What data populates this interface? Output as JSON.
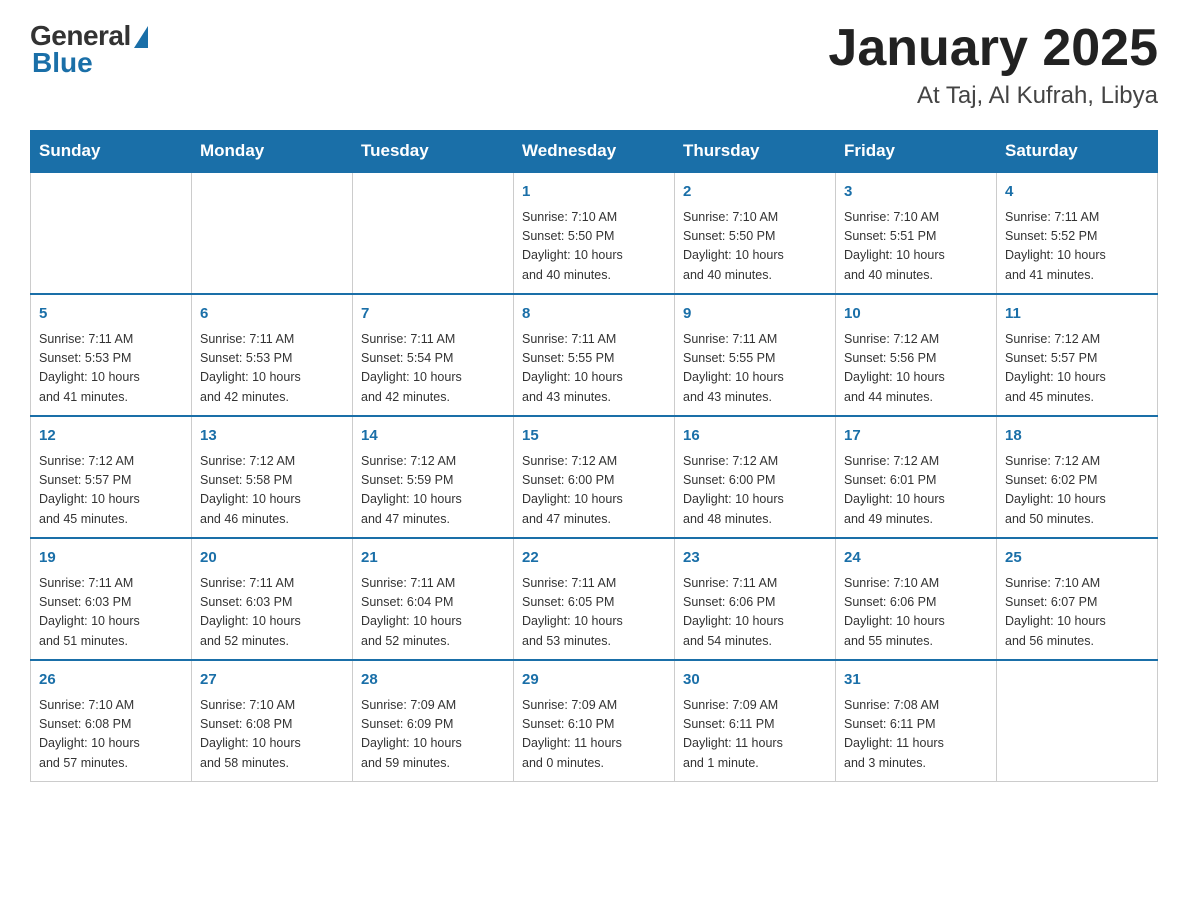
{
  "header": {
    "logo": {
      "general": "General",
      "blue": "Blue"
    },
    "title": "January 2025",
    "location": "At Taj, Al Kufrah, Libya"
  },
  "days_of_week": [
    "Sunday",
    "Monday",
    "Tuesday",
    "Wednesday",
    "Thursday",
    "Friday",
    "Saturday"
  ],
  "weeks": [
    [
      {
        "day": "",
        "info": ""
      },
      {
        "day": "",
        "info": ""
      },
      {
        "day": "",
        "info": ""
      },
      {
        "day": "1",
        "info": "Sunrise: 7:10 AM\nSunset: 5:50 PM\nDaylight: 10 hours\nand 40 minutes."
      },
      {
        "day": "2",
        "info": "Sunrise: 7:10 AM\nSunset: 5:50 PM\nDaylight: 10 hours\nand 40 minutes."
      },
      {
        "day": "3",
        "info": "Sunrise: 7:10 AM\nSunset: 5:51 PM\nDaylight: 10 hours\nand 40 minutes."
      },
      {
        "day": "4",
        "info": "Sunrise: 7:11 AM\nSunset: 5:52 PM\nDaylight: 10 hours\nand 41 minutes."
      }
    ],
    [
      {
        "day": "5",
        "info": "Sunrise: 7:11 AM\nSunset: 5:53 PM\nDaylight: 10 hours\nand 41 minutes."
      },
      {
        "day": "6",
        "info": "Sunrise: 7:11 AM\nSunset: 5:53 PM\nDaylight: 10 hours\nand 42 minutes."
      },
      {
        "day": "7",
        "info": "Sunrise: 7:11 AM\nSunset: 5:54 PM\nDaylight: 10 hours\nand 42 minutes."
      },
      {
        "day": "8",
        "info": "Sunrise: 7:11 AM\nSunset: 5:55 PM\nDaylight: 10 hours\nand 43 minutes."
      },
      {
        "day": "9",
        "info": "Sunrise: 7:11 AM\nSunset: 5:55 PM\nDaylight: 10 hours\nand 43 minutes."
      },
      {
        "day": "10",
        "info": "Sunrise: 7:12 AM\nSunset: 5:56 PM\nDaylight: 10 hours\nand 44 minutes."
      },
      {
        "day": "11",
        "info": "Sunrise: 7:12 AM\nSunset: 5:57 PM\nDaylight: 10 hours\nand 45 minutes."
      }
    ],
    [
      {
        "day": "12",
        "info": "Sunrise: 7:12 AM\nSunset: 5:57 PM\nDaylight: 10 hours\nand 45 minutes."
      },
      {
        "day": "13",
        "info": "Sunrise: 7:12 AM\nSunset: 5:58 PM\nDaylight: 10 hours\nand 46 minutes."
      },
      {
        "day": "14",
        "info": "Sunrise: 7:12 AM\nSunset: 5:59 PM\nDaylight: 10 hours\nand 47 minutes."
      },
      {
        "day": "15",
        "info": "Sunrise: 7:12 AM\nSunset: 6:00 PM\nDaylight: 10 hours\nand 47 minutes."
      },
      {
        "day": "16",
        "info": "Sunrise: 7:12 AM\nSunset: 6:00 PM\nDaylight: 10 hours\nand 48 minutes."
      },
      {
        "day": "17",
        "info": "Sunrise: 7:12 AM\nSunset: 6:01 PM\nDaylight: 10 hours\nand 49 minutes."
      },
      {
        "day": "18",
        "info": "Sunrise: 7:12 AM\nSunset: 6:02 PM\nDaylight: 10 hours\nand 50 minutes."
      }
    ],
    [
      {
        "day": "19",
        "info": "Sunrise: 7:11 AM\nSunset: 6:03 PM\nDaylight: 10 hours\nand 51 minutes."
      },
      {
        "day": "20",
        "info": "Sunrise: 7:11 AM\nSunset: 6:03 PM\nDaylight: 10 hours\nand 52 minutes."
      },
      {
        "day": "21",
        "info": "Sunrise: 7:11 AM\nSunset: 6:04 PM\nDaylight: 10 hours\nand 52 minutes."
      },
      {
        "day": "22",
        "info": "Sunrise: 7:11 AM\nSunset: 6:05 PM\nDaylight: 10 hours\nand 53 minutes."
      },
      {
        "day": "23",
        "info": "Sunrise: 7:11 AM\nSunset: 6:06 PM\nDaylight: 10 hours\nand 54 minutes."
      },
      {
        "day": "24",
        "info": "Sunrise: 7:10 AM\nSunset: 6:06 PM\nDaylight: 10 hours\nand 55 minutes."
      },
      {
        "day": "25",
        "info": "Sunrise: 7:10 AM\nSunset: 6:07 PM\nDaylight: 10 hours\nand 56 minutes."
      }
    ],
    [
      {
        "day": "26",
        "info": "Sunrise: 7:10 AM\nSunset: 6:08 PM\nDaylight: 10 hours\nand 57 minutes."
      },
      {
        "day": "27",
        "info": "Sunrise: 7:10 AM\nSunset: 6:08 PM\nDaylight: 10 hours\nand 58 minutes."
      },
      {
        "day": "28",
        "info": "Sunrise: 7:09 AM\nSunset: 6:09 PM\nDaylight: 10 hours\nand 59 minutes."
      },
      {
        "day": "29",
        "info": "Sunrise: 7:09 AM\nSunset: 6:10 PM\nDaylight: 11 hours\nand 0 minutes."
      },
      {
        "day": "30",
        "info": "Sunrise: 7:09 AM\nSunset: 6:11 PM\nDaylight: 11 hours\nand 1 minute."
      },
      {
        "day": "31",
        "info": "Sunrise: 7:08 AM\nSunset: 6:11 PM\nDaylight: 11 hours\nand 3 minutes."
      },
      {
        "day": "",
        "info": ""
      }
    ]
  ]
}
